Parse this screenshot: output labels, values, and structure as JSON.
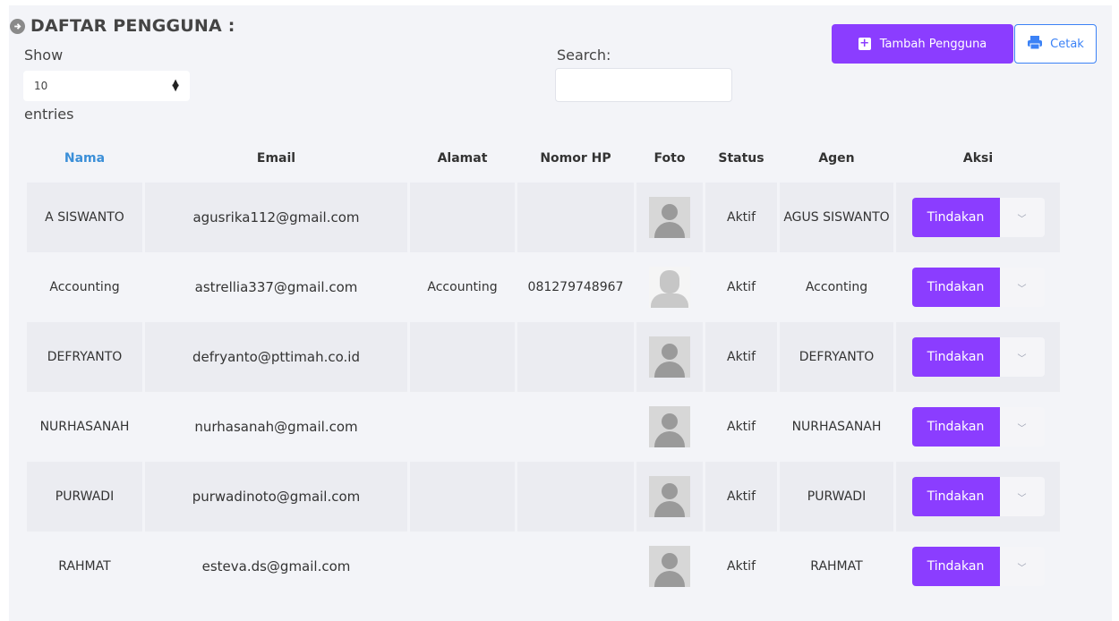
{
  "header": {
    "title": "DAFTAR PENGGUNA :"
  },
  "controls": {
    "show_label": "Show",
    "entries_value": "10",
    "entries_label": "entries",
    "search_label": "Search:",
    "search_value": "",
    "add_button_label": "Tambah Pengguna",
    "print_button_label": "Cetak"
  },
  "table": {
    "columns": [
      "Nama",
      "Email",
      "Alamat",
      "Nomor HP",
      "Foto",
      "Status",
      "Agen",
      "Aksi"
    ],
    "action_label": "Tindakan",
    "rows": [
      {
        "nama": "A SISWANTO",
        "email": "agusrika112@gmail.com",
        "alamat": "",
        "hp": "",
        "foto": "placeholder",
        "status": "Aktif",
        "agen": "AGUS SISWANTO"
      },
      {
        "nama": "Accounting",
        "email": "astrellia337@gmail.com",
        "alamat": "Accounting",
        "hp": "081279748967",
        "foto": "photo",
        "status": "Aktif",
        "agen": "Acconting"
      },
      {
        "nama": "DEFRYANTO",
        "email": "defryanto@pttimah.co.id",
        "alamat": "",
        "hp": "",
        "foto": "placeholder",
        "status": "Aktif",
        "agen": "DEFRYANTO"
      },
      {
        "nama": "NURHASANAH",
        "email": "nurhasanah@gmail.com",
        "alamat": "",
        "hp": "",
        "foto": "placeholder",
        "status": "Aktif",
        "agen": "NURHASANAH"
      },
      {
        "nama": "PURWADI",
        "email": "purwadinoto@gmail.com",
        "alamat": "",
        "hp": "",
        "foto": "placeholder",
        "status": "Aktif",
        "agen": "PURWADI"
      },
      {
        "nama": "RAHMAT",
        "email": "esteva.ds@gmail.com",
        "alamat": "",
        "hp": "",
        "foto": "placeholder",
        "status": "Aktif",
        "agen": "RAHMAT"
      }
    ]
  },
  "colors": {
    "accent": "#8b3dff",
    "print_blue": "#3b82f6",
    "sorted_header": "#3b8fd8"
  },
  "icons": {
    "title": "arrow-circle-right-icon",
    "add": "plus-square-icon",
    "print": "printer-icon",
    "caret": "chevron-down-icon",
    "select": "sort-arrows-icon"
  }
}
